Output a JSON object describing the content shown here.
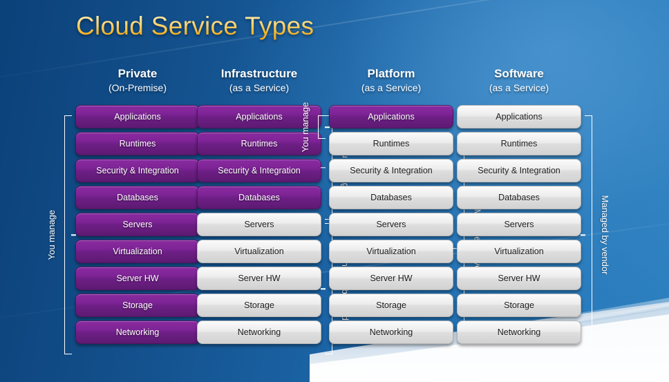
{
  "title": "Cloud Service Types",
  "colors": {
    "purple": "#7e2496",
    "grey": "#e4e4e4",
    "title_gold": "#f2b62e",
    "bg_blue_dark": "#0c4179",
    "bg_blue_light": "#2d80bf",
    "bracket_white": "#ffffff"
  },
  "labels": {
    "you_manage": "You manage",
    "managed_by_vendor": "Managed by vendor"
  },
  "layers": [
    "Applications",
    "Runtimes",
    "Security & Integration",
    "Databases",
    "Servers",
    "Virtualization",
    "Server HW",
    "Storage",
    "Networking"
  ],
  "columns": [
    {
      "name": "Private",
      "subtitle": "(On-Premise)",
      "managed_count": 9,
      "rows": [
        {
          "label": "Applications",
          "style": "purple"
        },
        {
          "label": "Runtimes",
          "style": "purple"
        },
        {
          "label": "Security & Integration",
          "style": "purple"
        },
        {
          "label": "Databases",
          "style": "purple"
        },
        {
          "label": "Servers",
          "style": "purple"
        },
        {
          "label": "Virtualization",
          "style": "purple"
        },
        {
          "label": "Server HW",
          "style": "purple"
        },
        {
          "label": "Storage",
          "style": "purple"
        },
        {
          "label": "Networking",
          "style": "purple"
        }
      ],
      "brackets": [
        {
          "side": "left",
          "label": "You manage",
          "from": 0,
          "to": 8
        }
      ]
    },
    {
      "name": "Infrastructure",
      "subtitle": "(as a Service)",
      "managed_count": 4,
      "rows": [
        {
          "label": "Applications",
          "style": "purple"
        },
        {
          "label": "Runtimes",
          "style": "purple"
        },
        {
          "label": "Security & Integration",
          "style": "purple"
        },
        {
          "label": "Databases",
          "style": "purple"
        },
        {
          "label": "Servers",
          "style": "grey"
        },
        {
          "label": "Virtualization",
          "style": "grey"
        },
        {
          "label": "Server HW",
          "style": "grey"
        },
        {
          "label": "Storage",
          "style": "grey"
        },
        {
          "label": "Networking",
          "style": "grey"
        }
      ],
      "brackets": [
        {
          "side": "right",
          "label": "You manage",
          "from": 0,
          "to": 3
        },
        {
          "side": "right",
          "label": "Managed by vendor",
          "from": 4,
          "to": 8
        }
      ]
    },
    {
      "name": "Platform",
      "subtitle": "(as a Service)",
      "managed_count": 1,
      "rows": [
        {
          "label": "Applications",
          "style": "purple"
        },
        {
          "label": "Runtimes",
          "style": "grey"
        },
        {
          "label": "Security & Integration",
          "style": "grey"
        },
        {
          "label": "Databases",
          "style": "grey"
        },
        {
          "label": "Servers",
          "style": "grey"
        },
        {
          "label": "Virtualization",
          "style": "grey"
        },
        {
          "label": "Server HW",
          "style": "grey"
        },
        {
          "label": "Storage",
          "style": "grey"
        },
        {
          "label": "Networking",
          "style": "grey"
        }
      ],
      "brackets": [
        {
          "side": "left",
          "label": "You manage",
          "from": 0,
          "to": 0
        },
        {
          "side": "right",
          "label": "Managed by vendor",
          "from": 1,
          "to": 8
        }
      ]
    },
    {
      "name": "Software",
      "subtitle": "(as a Service)",
      "managed_count": 0,
      "rows": [
        {
          "label": "Applications",
          "style": "grey"
        },
        {
          "label": "Runtimes",
          "style": "grey"
        },
        {
          "label": "Security & Integration",
          "style": "grey"
        },
        {
          "label": "Databases",
          "style": "grey"
        },
        {
          "label": "Servers",
          "style": "grey"
        },
        {
          "label": "Virtualization",
          "style": "grey"
        },
        {
          "label": "Server HW",
          "style": "grey"
        },
        {
          "label": "Storage",
          "style": "grey"
        },
        {
          "label": "Networking",
          "style": "grey"
        }
      ],
      "brackets": [
        {
          "side": "right",
          "label": "Managed by vendor",
          "from": 0,
          "to": 8
        }
      ]
    }
  ]
}
